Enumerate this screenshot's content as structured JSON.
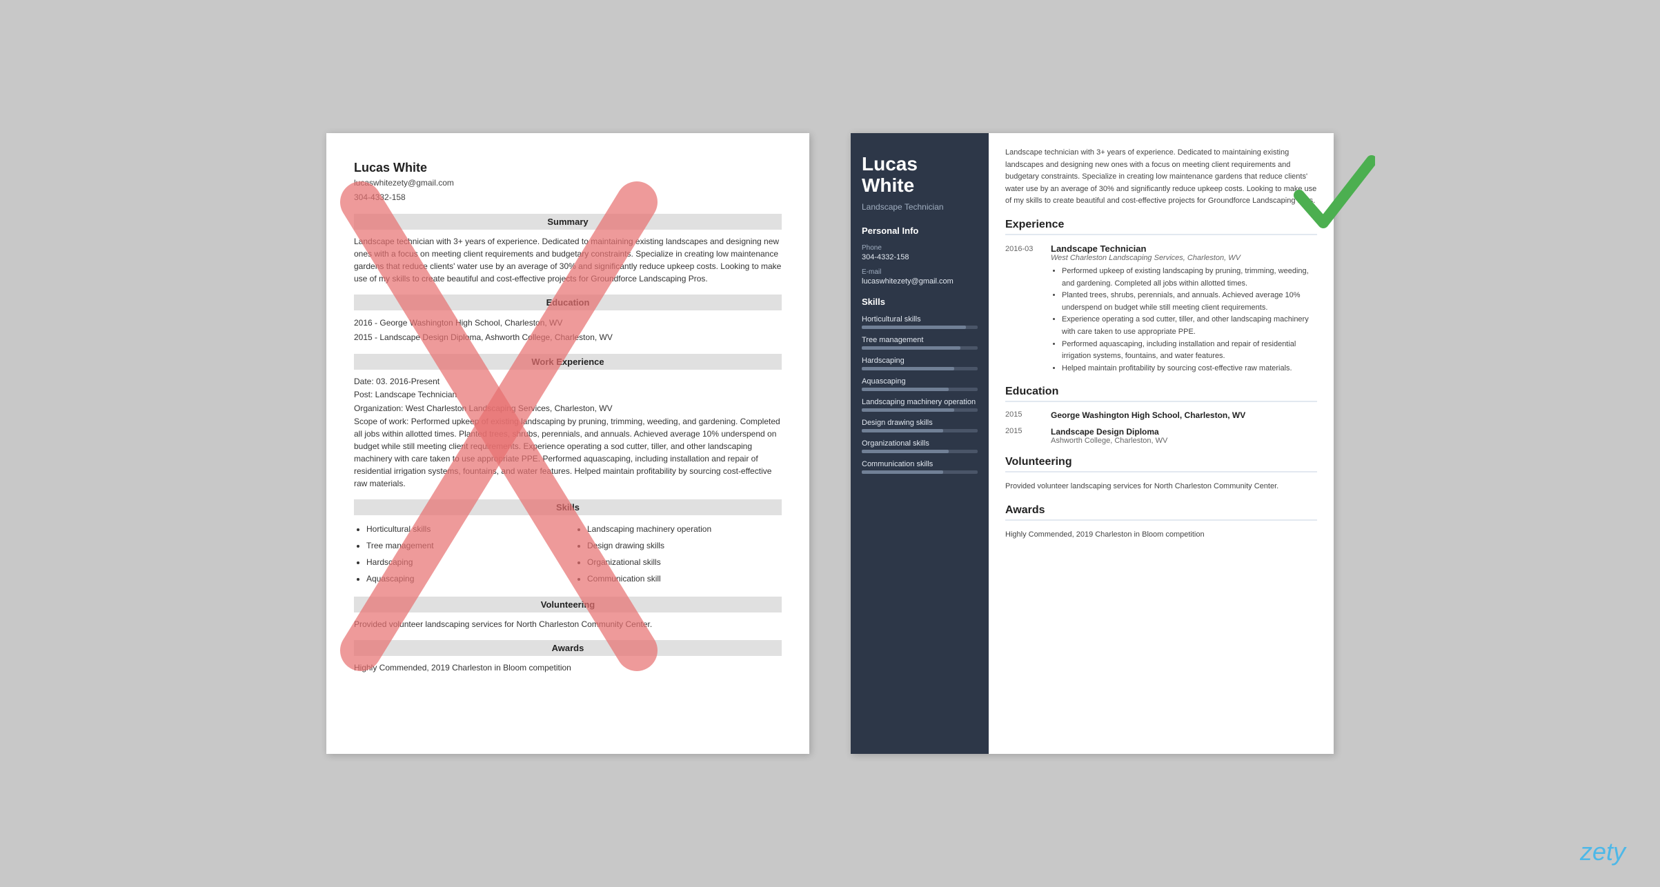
{
  "left_resume": {
    "name": "Lucas White",
    "email": "lucaswhitezety@gmail.com",
    "phone": "304-4332-158",
    "summary_title": "Summary",
    "summary_text": "Landscape technician with 3+ years of experience. Dedicated to maintaining existing landscapes and designing new ones with a focus on meeting client requirements and budgetary constraints. Specialize in creating low maintenance gardens that reduce clients' water use by an average of 30% and significantly reduce upkeep costs. Looking to make use of my skills to create beautiful and cost-effective projects for Groundforce Landscaping Pros.",
    "education_title": "Education",
    "edu_items": [
      "2016 - George Washington High School, Charleston, WV",
      "2015 - Landscape Design Diploma, Ashworth College, Charleston, WV"
    ],
    "work_title": "Work Experience",
    "work_date": "Date: 03. 2016-Present",
    "work_post": "Post: Landscape Technician",
    "work_org": "Organization: West Charleston Landscaping Services, Charleston, WV",
    "work_scope_label": "Scope of work:",
    "work_scope": "Performed upkeep of existing landscaping by pruning, trimming, weeding, and gardening. Completed all jobs within allotted times. Planted trees, shrubs, perennials, and annuals. Achieved average 10% underspend on budget while still meeting client requirements. Experience operating a sod cutter, tiller, and other landscaping machinery with care taken to use appropriate PPE. Performed aquascaping, including installation and repair of residential irrigation systems, fountains, and water features. Helped maintain profitability by sourcing cost-effective raw materials.",
    "skills_title": "Skills",
    "skills_col1": [
      "Horticultural skills",
      "Tree management",
      "Hardscaping",
      "Aquascaping"
    ],
    "skills_col2": [
      "Landscaping machinery operation",
      "Design drawing skills",
      "Organizational skills",
      "Communication skill"
    ],
    "volunteering_title": "Volunteering",
    "volunteering_text": "Provided volunteer landscaping services for North Charleston Community Center.",
    "awards_title": "Awards",
    "awards_text": "Highly Commended, 2019 Charleston in Bloom competition"
  },
  "right_resume": {
    "first_name": "Lucas",
    "last_name": "White",
    "job_title": "Landscape Technician",
    "personal_info_title": "Personal Info",
    "phone_label": "Phone",
    "phone_value": "304-4332-158",
    "email_label": "E-mail",
    "email_value": "lucaswhitezety@gmail.com",
    "skills_title": "Skills",
    "skills": [
      {
        "name": "Horticultural skills",
        "level": 90
      },
      {
        "name": "Tree management",
        "level": 85
      },
      {
        "name": "Hardscaping",
        "level": 80
      },
      {
        "name": "Aquascaping",
        "level": 75
      },
      {
        "name": "Landscaping machinery operation",
        "level": 80
      },
      {
        "name": "Design drawing skills",
        "level": 70
      },
      {
        "name": "Organizational skills",
        "level": 75
      },
      {
        "name": "Communication skills",
        "level": 70
      }
    ],
    "summary_text": "Landscape technician with 3+ years of experience. Dedicated to maintaining existing landscapes and designing new ones with a focus on meeting client requirements and budgetary constraints. Specialize in creating low maintenance gardens that reduce clients' water use by an average of 30% and significantly reduce upkeep costs. Looking to make use of my skills to create beautiful and cost-effective projects for Groundforce Landscaping Pros.",
    "experience_title": "Experience",
    "experience_date": "2016-03",
    "exp_job_title": "Landscape Technician",
    "exp_company": "West Charleston Landscaping Services, Charleston, WV",
    "exp_bullets": [
      "Performed upkeep of existing landscaping by pruning, trimming, weeding, and gardening. Completed all jobs within allotted times.",
      "Planted trees, shrubs, perennials, and annuals. Achieved average 10% underspend on budget while still meeting client requirements.",
      "Experience operating a sod cutter, tiller, and other landscaping machinery with care taken to use appropriate PPE.",
      "Performed aquascaping, including installation and repair of residential irrigation systems, fountains, and water features.",
      "Helped maintain profitability by sourcing cost-effective raw materials."
    ],
    "education_title": "Education",
    "edu_entries": [
      {
        "year": "2015",
        "title": "George Washington High School, Charleston, WV",
        "subtitle": ""
      },
      {
        "year": "2015",
        "title": "Landscape Design Diploma",
        "subtitle": "Ashworth College, Charleston, WV"
      }
    ],
    "volunteering_title": "Volunteering",
    "volunteering_text": "Provided volunteer landscaping services for North Charleston Community Center.",
    "awards_title": "Awards",
    "awards_text": "Highly Commended, 2019 Charleston in Bloom competition"
  },
  "zety_logo": "zety"
}
